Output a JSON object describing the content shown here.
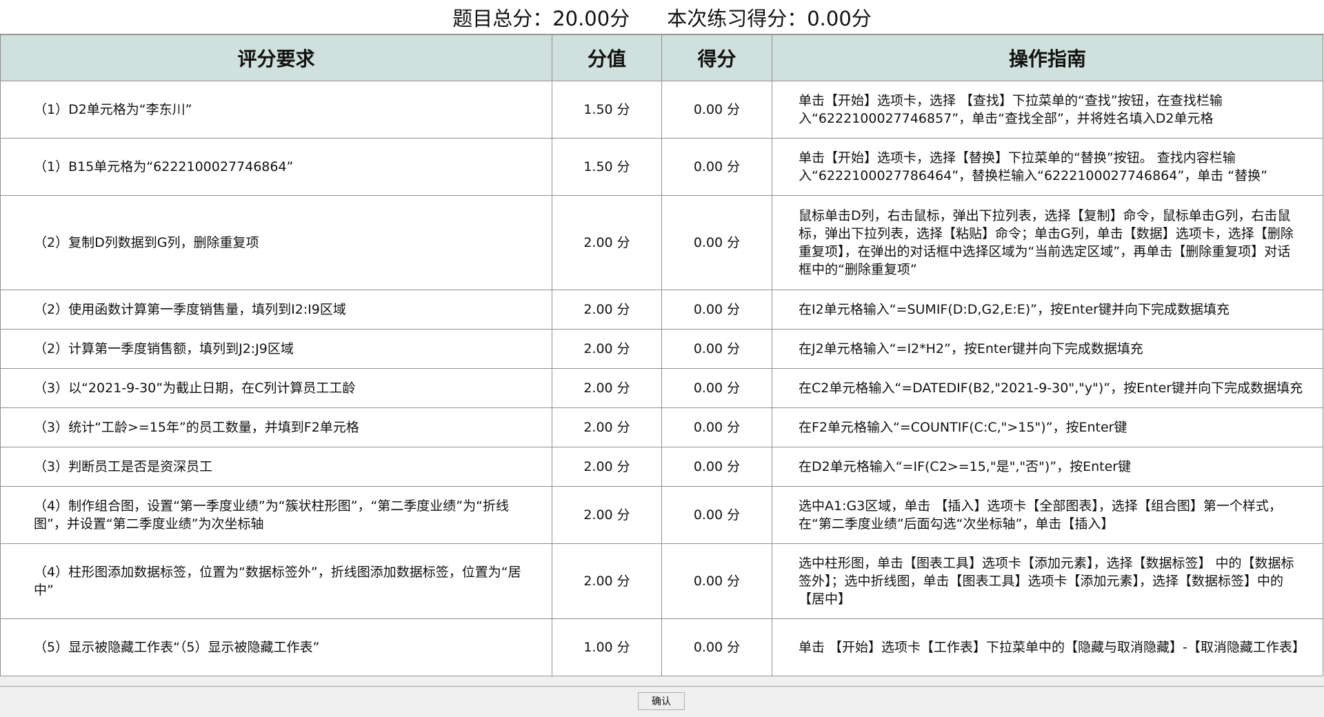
{
  "header": {
    "total_score": "题目总分：20.00分",
    "practice_score": "本次练习得分：0.00分"
  },
  "table": {
    "columns": [
      "评分要求",
      "分值",
      "得分",
      "操作指南"
    ],
    "rows": [
      {
        "requirement": "（1）D2单元格为“李东川”",
        "value": "1.50 分",
        "score": "0.00 分",
        "guide": "单击【开始】选项卡，选择 【查找】下拉菜单的“查找”按钮，在查找栏输入“6222100027746857”，单击“查找全部”，并将姓名填入D2单元格"
      },
      {
        "requirement": "（1）B15单元格为“6222100027746864”",
        "value": "1.50 分",
        "score": "0.00 分",
        "guide": "单击【开始】选项卡，选择【替换】下拉菜单的“替换”按钮。 查找内容栏输入“6222100027786464”，替换栏输入“6222100027746864”，单击 “替换”"
      },
      {
        "requirement": "（2）复制D列数据到G列，删除重复项",
        "value": "2.00 分",
        "score": "0.00 分",
        "guide": "鼠标单击D列，右击鼠标，弹出下拉列表，选择【复制】命令，鼠标单击G列，右击鼠标，弹出下拉列表，选择【粘贴】命令；单击G列，单击【数据】选项卡，选择【删除重复项】，在弹出的对话框中选择区域为“当前选定区域”，再单击【删除重复项】对话框中的“删除重复项”"
      },
      {
        "requirement": "（2）使用函数计算第一季度销售量，填列到I2:I9区域",
        "value": "2.00 分",
        "score": "0.00 分",
        "guide": "在I2单元格输入“=SUMIF(D:D,G2,E:E)”，按Enter键并向下完成数据填充"
      },
      {
        "requirement": "（2）计算第一季度销售额，填列到J2:J9区域",
        "value": "2.00 分",
        "score": "0.00 分",
        "guide": "在J2单元格输入“=I2*H2”，按Enter键并向下完成数据填充"
      },
      {
        "requirement": "（3）以“2021-9-30”为截止日期，在C列计算员工工龄",
        "value": "2.00 分",
        "score": "0.00 分",
        "guide": "在C2单元格输入“=DATEDIF(B2,\"2021-9-30\",\"y\")”，按Enter键并向下完成数据填充"
      },
      {
        "requirement": "（3）统计“工龄>=15年”的员工数量，并填到F2单元格",
        "value": "2.00 分",
        "score": "0.00 分",
        "guide": "在F2单元格输入“=COUNTIF(C:C,\">15\")”，按Enter键"
      },
      {
        "requirement": "（3）判断员工是否是资深员工",
        "value": "2.00 分",
        "score": "0.00 分",
        "guide": "在D2单元格输入“=IF(C2>=15,\"是\",\"否\")”，按Enter键"
      },
      {
        "requirement": "（4）制作组合图，设置“第一季度业绩”为“簇状柱形图”，“第二季度业绩”为“折线图”，并设置“第二季度业绩”为次坐标轴",
        "value": "2.00 分",
        "score": "0.00 分",
        "guide": "选中A1:G3区域，单击 【插入】选项卡【全部图表】，选择【组合图】第一个样式，在“第二季度业绩”后面勾选“次坐标轴”，单击【插入】"
      },
      {
        "requirement": "（4）柱形图添加数据标签，位置为“数据标签外”，折线图添加数据标签，位置为“居中”",
        "value": "2.00 分",
        "score": "0.00 分",
        "guide": "选中柱形图，单击【图表工具】选项卡【添加元素】，选择【数据标签】 中的【数据标签外】；选中折线图，单击【图表工具】选项卡【添加元素】，选择【数据标签】中的【居中】"
      },
      {
        "requirement": "（5）显示被隐藏工作表“（5）显示被隐藏工作表”",
        "value": "1.00 分",
        "score": "0.00 分",
        "guide": "单击 【开始】选项卡【工作表】下拉菜单中的【隐藏与取消隐藏】-【取消隐藏工作表】"
      }
    ]
  },
  "footer": {
    "confirm_label": "确认"
  },
  "colors": {
    "header_bg": "#cfe0dd",
    "grid_line": "#8f8f8f",
    "footer_bg": "#f0f0f0"
  }
}
